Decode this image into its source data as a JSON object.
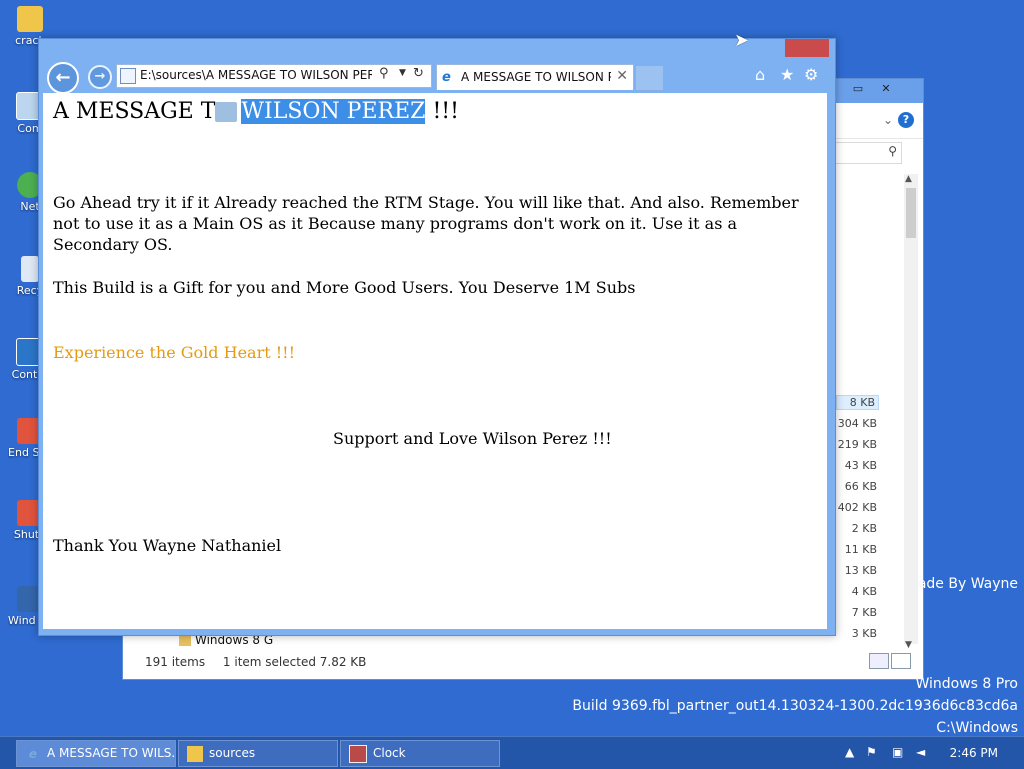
{
  "desktop": {
    "icons": [
      {
        "label": "crack",
        "icon": "folder-icon"
      },
      {
        "label": "Com",
        "icon": "computer-icon"
      },
      {
        "label": "Net",
        "icon": "network-icon"
      },
      {
        "label": "Recy",
        "icon": "recycle-bin-icon"
      },
      {
        "label": "Contro",
        "icon": "control-panel-icon"
      },
      {
        "label": "End Ses",
        "icon": "shortcut-icon"
      },
      {
        "label": "Shutd",
        "icon": "shortcut-icon"
      },
      {
        "label": "Wind Gold Editi...",
        "icon": "shortcut-icon"
      }
    ],
    "watermark": {
      "made_by": "ade By Wayne",
      "edition": "Windows 8 Pro",
      "build": "Build 9369.fbl_partner_out14.130324-1300.2dc1936d6c83cd6a",
      "path": "C:\\Windows"
    }
  },
  "explorer": {
    "sizes": [
      "8 KB",
      "304 KB",
      "219 KB",
      "43 KB",
      "66 KB",
      "402 KB",
      "2 KB",
      "11 KB",
      "13 KB",
      "4 KB",
      "7 KB",
      "3 KB"
    ],
    "breadcrumb_row": "Windows 8 G",
    "status": {
      "items": "191 items",
      "selected": "1 item selected  7.82 KB"
    },
    "help_label": "?"
  },
  "ie": {
    "address": "E:\\sources\\A MESSAGE TO WILSON PEREZ.ht",
    "tab_title": "A MESSAGE TO WILSON PE...",
    "content": {
      "heading_pre": "A MESSAGE T",
      "heading_hl": "WILSON PEREZ",
      "heading_post": " !!!",
      "para1": "Go Ahead try it if it Already reached the RTM Stage. You will like that. And also. Remember not to use it as a Main OS as it Because many programs don't work on it. Use it as a Secondary OS.",
      "para2": "This Build is a Gift for you and More Good Users. You Deserve 1M Subs",
      "para3": "Experience the Gold Heart !!!",
      "para4": "Support and Love Wilson Perez !!!",
      "para5": "Thank You Wayne Nathaniel"
    }
  },
  "taskbar": {
    "items": [
      {
        "label": "A MESSAGE TO WILS...",
        "icon": "ie-icon"
      },
      {
        "label": "sources",
        "icon": "folder-icon"
      },
      {
        "label": "Clock",
        "icon": "clock-icon"
      }
    ],
    "time": "2:46 PM"
  },
  "colors": {
    "desktop": "#2f6bd1",
    "taskbar": "#2355a8",
    "gold_text": "#e39b14",
    "selection": "#3d8ee6"
  }
}
